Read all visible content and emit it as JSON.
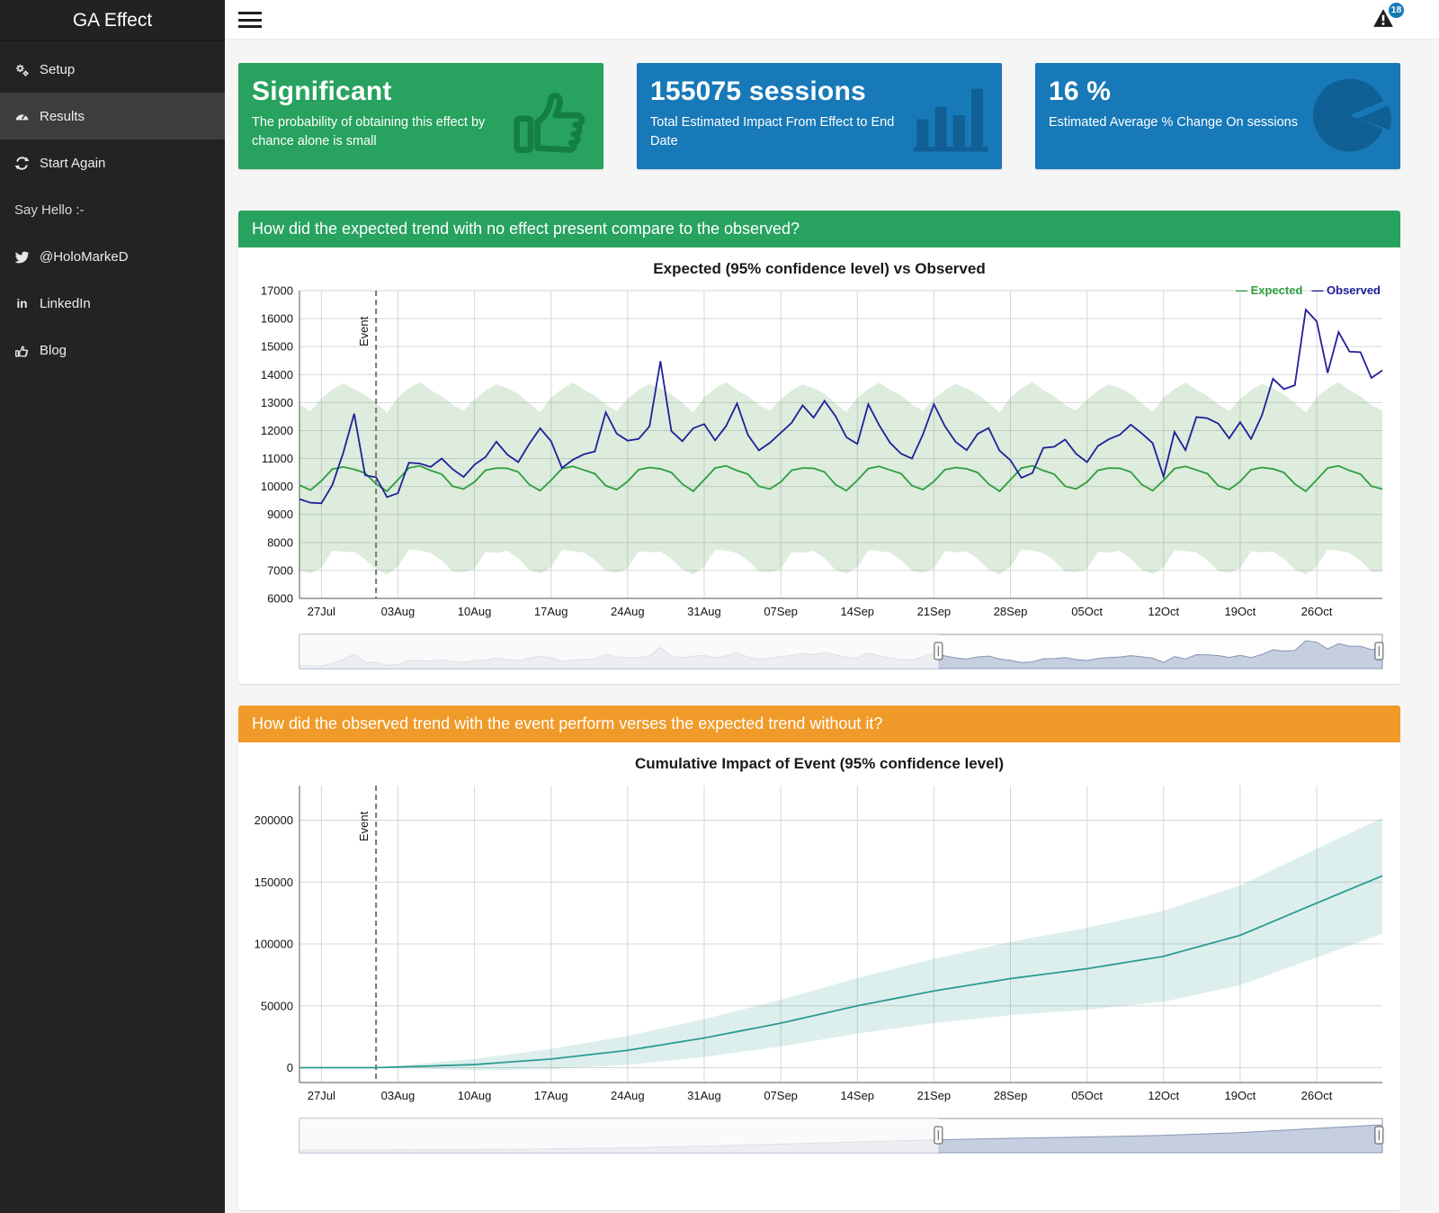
{
  "sidebar": {
    "title": "GA Effect",
    "items": [
      {
        "label": "Setup",
        "icon": "gears-icon"
      },
      {
        "label": "Results",
        "icon": "dashboard-icon",
        "active": true
      },
      {
        "label": "Start Again",
        "icon": "refresh-icon"
      },
      {
        "label": "Say Hello :-",
        "icon": null
      },
      {
        "label": "@HoloMarkeD",
        "icon": "twitter-icon"
      },
      {
        "label": "LinkedIn",
        "icon": "linkedin-icon"
      },
      {
        "label": "Blog",
        "icon": "thumbs-up-icon"
      }
    ]
  },
  "header": {
    "notification_count": "18"
  },
  "value_boxes": [
    {
      "value": "Significant",
      "subtitle": "The probability of obtaining this effect by chance alone is small",
      "color": "#27a25f",
      "icon": "thumbs-up-icon"
    },
    {
      "value": "155075 sessions",
      "subtitle": "Total Estimated Impact From Effect to End Date",
      "color": "#1779b8",
      "icon": "bar-chart-icon"
    },
    {
      "value": "16 %",
      "subtitle": "Estimated Average % Change On sessions",
      "color": "#1779b8",
      "icon": "pie-chart-icon"
    }
  ],
  "section_headers": [
    {
      "text": "How did the expected trend with no effect present compare to the observed?",
      "color": "#27a25f"
    },
    {
      "text": "How did the observed trend with the event perform verses the expected trend without it?",
      "color": "#f09b29"
    }
  ],
  "chart_data": [
    {
      "type": "line",
      "title": "Expected (95% confidence level) vs Observed",
      "grid": true,
      "show_legend": true,
      "legend_position": "top-right",
      "ylim": [
        6000,
        17000
      ],
      "yticks": [
        6000,
        7000,
        8000,
        9000,
        10000,
        11000,
        12000,
        13000,
        14000,
        15000,
        16000,
        17000
      ],
      "n_points": 100,
      "x_tick_labels": [
        "27Jul",
        "03Aug",
        "10Aug",
        "17Aug",
        "24Aug",
        "31Aug",
        "07Sep",
        "14Sep",
        "21Sep",
        "28Sep",
        "05Oct",
        "12Oct",
        "19Oct",
        "26Oct"
      ],
      "x_tick_indices": [
        2,
        9,
        16,
        23,
        30,
        37,
        44,
        51,
        58,
        65,
        72,
        79,
        86,
        93
      ],
      "event": {
        "index": 7,
        "label": "Event"
      },
      "series": [
        {
          "name": "Expected",
          "color": "#2f9e3f",
          "values": [
            10050,
            9870,
            10200,
            10620,
            10700,
            10610,
            10480,
            10090,
            9830,
            10240,
            10660,
            10740,
            10570,
            10440,
            10010,
            9910,
            10160,
            10580,
            10660,
            10650,
            10520,
            10070,
            9850,
            10220,
            10640,
            10720,
            10590,
            10460,
            10030,
            9890,
            10180,
            10600,
            10680,
            10630,
            10500,
            10090,
            9830,
            10240,
            10660,
            10740,
            10570,
            10440,
            10010,
            9910,
            10160,
            10580,
            10660,
            10650,
            10520,
            10070,
            9850,
            10220,
            10640,
            10720,
            10590,
            10460,
            10030,
            9890,
            10180,
            10600,
            10680,
            10630,
            10500,
            10090,
            9830,
            10240,
            10660,
            10740,
            10570,
            10440,
            10010,
            9910,
            10160,
            10580,
            10660,
            10650,
            10520,
            10070,
            9850,
            10220,
            10640,
            10720,
            10590,
            10460,
            10030,
            9890,
            10180,
            10600,
            10680,
            10630,
            10500,
            10090,
            9830,
            10240,
            10660,
            10740,
            10570,
            10440,
            10010,
            9910
          ]
        },
        {
          "name": "Observed",
          "color": "#202099",
          "values": [
            9550,
            9420,
            9400,
            10050,
            11200,
            12600,
            10400,
            10330,
            9620,
            9760,
            10850,
            10820,
            10700,
            11000,
            10620,
            10340,
            10780,
            11050,
            11600,
            11140,
            10870,
            11520,
            12080,
            11620,
            10660,
            10960,
            11150,
            11250,
            12650,
            11890,
            11640,
            11700,
            12150,
            14480,
            11980,
            11620,
            12080,
            12230,
            11650,
            12160,
            12970,
            11840,
            11290,
            11560,
            11920,
            12280,
            12900,
            12460,
            13060,
            12520,
            11760,
            11520,
            12940,
            12190,
            11560,
            11170,
            11000,
            11860,
            12940,
            12160,
            11590,
            11300,
            11880,
            12090,
            11280,
            10940,
            10310,
            10480,
            11380,
            11420,
            11680,
            11170,
            10870,
            11450,
            11690,
            11850,
            12210,
            11900,
            11550,
            10350,
            11950,
            11300,
            12480,
            12440,
            12250,
            11720,
            12300,
            11700,
            12550,
            13850,
            13480,
            13620,
            16320,
            15900,
            14060,
            15520,
            14820,
            14800,
            13880,
            14150
          ]
        }
      ],
      "band": {
        "series": "Expected",
        "color": "rgba(100,170,100,0.22)",
        "upper": [
          12950,
          12680,
          13150,
          13470,
          13690,
          13480,
          13270,
          12990,
          12640,
          13190,
          13510,
          13730,
          13440,
          13230,
          12910,
          12720,
          13110,
          13430,
          13650,
          13520,
          13310,
          12970,
          12660,
          13170,
          13490,
          13710,
          13460,
          13250,
          12930,
          12700,
          13130,
          13450,
          13670,
          13500,
          13290,
          12990,
          12640,
          13190,
          13510,
          13730,
          13440,
          13230,
          12910,
          12720,
          13110,
          13430,
          13650,
          13520,
          13310,
          12970,
          12660,
          13170,
          13490,
          13710,
          13460,
          13250,
          12930,
          12700,
          13130,
          13450,
          13670,
          13500,
          13290,
          12990,
          12640,
          13190,
          13510,
          13730,
          13440,
          13230,
          12910,
          12720,
          13110,
          13430,
          13650,
          13520,
          13310,
          12970,
          12660,
          13170,
          13490,
          13710,
          13460,
          13250,
          12930,
          12700,
          13130,
          13450,
          13670,
          13500,
          13290,
          12990,
          12640,
          13190,
          13510,
          13730,
          13440,
          13230,
          12910,
          12720
        ],
        "lower": [
          7000,
          6900,
          7090,
          7710,
          7670,
          7660,
          7390,
          7040,
          6860,
          7130,
          7750,
          7710,
          7620,
          7350,
          6960,
          6940,
          7050,
          7670,
          7630,
          7700,
          7430,
          7020,
          6880,
          7110,
          7730,
          7690,
          7640,
          7370,
          6980,
          6920,
          7070,
          7690,
          7650,
          7680,
          7410,
          7040,
          6860,
          7130,
          7750,
          7710,
          7620,
          7350,
          6960,
          6940,
          7050,
          7670,
          7630,
          7700,
          7430,
          7020,
          6880,
          7110,
          7730,
          7690,
          7640,
          7370,
          6980,
          6920,
          7070,
          7690,
          7650,
          7680,
          7410,
          7040,
          6860,
          7130,
          7750,
          7710,
          7620,
          7350,
          6960,
          6940,
          7050,
          7670,
          7630,
          7700,
          7430,
          7020,
          6880,
          7110,
          7730,
          7690,
          7640,
          7370,
          6980,
          6920,
          7070,
          7690,
          7650,
          7680,
          7410,
          7040,
          6860,
          7130,
          7750,
          7710,
          7620,
          7350,
          6960,
          6940
        ]
      },
      "range_selector": {
        "select_start_frac": 0.59,
        "select_end_frac": 0.997,
        "mini_series": 1
      }
    },
    {
      "type": "line",
      "title": "Cumulative Impact of Event (95% confidence level)",
      "grid": true,
      "show_legend": false,
      "ylim": [
        -12000,
        228000
      ],
      "yticks": [
        0,
        50000,
        100000,
        150000,
        200000
      ],
      "n_points": 100,
      "x_tick_labels": [
        "27Jul",
        "03Aug",
        "10Aug",
        "17Aug",
        "24Aug",
        "31Aug",
        "07Sep",
        "14Sep",
        "21Sep",
        "28Sep",
        "05Oct",
        "12Oct",
        "19Oct",
        "26Oct"
      ],
      "x_tick_indices": [
        2,
        9,
        16,
        23,
        30,
        37,
        44,
        51,
        58,
        65,
        72,
        79,
        86,
        93
      ],
      "event": {
        "index": 7,
        "label": "Event"
      },
      "series": [
        {
          "name": "Cumulative Impact",
          "color": "#2b9b92",
          "values": [
            0,
            0,
            0,
            0,
            0,
            0,
            0,
            0,
            280,
            560,
            830,
            1110,
            1390,
            1670,
            1940,
            2220,
            2500,
            3140,
            3790,
            4430,
            5070,
            5710,
            6360,
            7000,
            8000,
            9000,
            10000,
            11000,
            12000,
            13000,
            14000,
            15430,
            16860,
            18290,
            19710,
            21140,
            22570,
            24000,
            25710,
            27430,
            29140,
            30860,
            32570,
            34290,
            36000,
            38000,
            40000,
            42000,
            44000,
            46000,
            48000,
            50000,
            51710,
            53430,
            55140,
            56860,
            58570,
            60290,
            62000,
            63430,
            64860,
            66290,
            67710,
            69140,
            70570,
            72000,
            73140,
            74290,
            75430,
            76570,
            77710,
            78860,
            80000,
            81430,
            82860,
            84290,
            85710,
            87140,
            88570,
            90000,
            92430,
            94860,
            97290,
            99710,
            102140,
            104570,
            107000,
            110710,
            114430,
            118140,
            121860,
            125570,
            129290,
            133000,
            136680,
            140360,
            144040,
            147720,
            151400,
            155075
          ]
        }
      ],
      "band": {
        "series": "Cumulative Impact",
        "color": "rgba(43,155,146,0.16)",
        "upper": [
          0,
          0,
          0,
          0,
          0,
          0,
          0,
          0,
          790,
          1580,
          2360,
          3150,
          3940,
          4730,
          5510,
          6300,
          7090,
          8240,
          9400,
          10550,
          11700,
          12850,
          14010,
          15160,
          16670,
          18180,
          19690,
          21200,
          22710,
          24220,
          25730,
          27670,
          29610,
          31550,
          33480,
          35420,
          37360,
          39300,
          41520,
          43750,
          45970,
          48200,
          50420,
          52650,
          54870,
          57380,
          59890,
          62400,
          64910,
          67420,
          69930,
          72440,
          74660,
          76890,
          79110,
          81340,
          83560,
          85790,
          88010,
          89950,
          91890,
          93830,
          95760,
          97700,
          99640,
          101580,
          103230,
          104890,
          106540,
          108190,
          109840,
          111500,
          113150,
          115090,
          117030,
          118970,
          120900,
          122840,
          124780,
          126720,
          129660,
          132600,
          135540,
          138470,
          141410,
          144350,
          147290,
          151510,
          155740,
          159960,
          164190,
          168410,
          172640,
          176860,
          181050,
          185240,
          189430,
          193620,
          197810,
          201995
        ],
        "lower": [
          0,
          0,
          0,
          0,
          0,
          0,
          0,
          0,
          -230,
          -460,
          -700,
          -930,
          -1160,
          -1390,
          -1630,
          -1860,
          -2090,
          -1960,
          -1820,
          -1690,
          -1560,
          -1430,
          -1290,
          -1160,
          -670,
          -180,
          310,
          800,
          1290,
          1780,
          2270,
          3190,
          4110,
          5030,
          5940,
          6860,
          7780,
          8700,
          9900,
          11110,
          12310,
          13520,
          14720,
          15930,
          17130,
          18620,
          20110,
          21600,
          23090,
          24580,
          26070,
          27560,
          28760,
          29970,
          31170,
          32380,
          33580,
          34790,
          35990,
          36910,
          37830,
          38750,
          39660,
          40580,
          41500,
          42420,
          43050,
          43690,
          44320,
          44950,
          45580,
          46220,
          46850,
          47770,
          48690,
          49610,
          50520,
          51440,
          52360,
          53280,
          55200,
          57120,
          59040,
          60950,
          62870,
          64790,
          66710,
          69910,
          73120,
          76320,
          79530,
          82730,
          85940,
          89140,
          92310,
          95480,
          98650,
          101820,
          104990,
          108155
        ]
      },
      "range_selector": {
        "select_start_frac": 0.59,
        "select_end_frac": 0.997,
        "mini_series": 0
      }
    }
  ]
}
